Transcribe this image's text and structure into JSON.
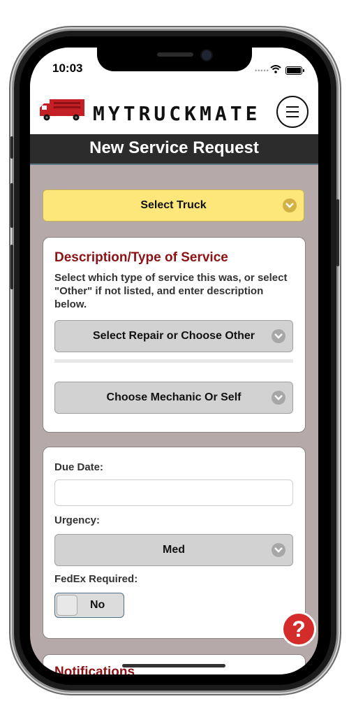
{
  "status_bar": {
    "time": "10:03"
  },
  "header": {
    "brand_name": "MYTRUCKMATE",
    "menu_icon": "hamburger-menu-icon"
  },
  "title_bar": {
    "title": "New Service Request"
  },
  "truck_select": {
    "label": "Select Truck"
  },
  "description_section": {
    "title": "Description/Type of Service",
    "instructions": "Select which type of service this was, or select \"Other\" if not listed, and enter description below.",
    "repair_select": "Select Repair or Choose Other",
    "mechanic_select": "Choose Mechanic Or Self"
  },
  "details_section": {
    "due_date_label": "Due Date:",
    "due_date_value": "",
    "urgency_label": "Urgency:",
    "urgency_value": "Med",
    "fedex_label": "FedEx Required:",
    "fedex_toggle": "No"
  },
  "notifications_section": {
    "title": "Notifications"
  },
  "help": {
    "symbol": "?"
  },
  "colors": {
    "accent_red": "#8b1316",
    "select_yellow": "#fde67a",
    "title_bar": "#2c2c2c"
  }
}
